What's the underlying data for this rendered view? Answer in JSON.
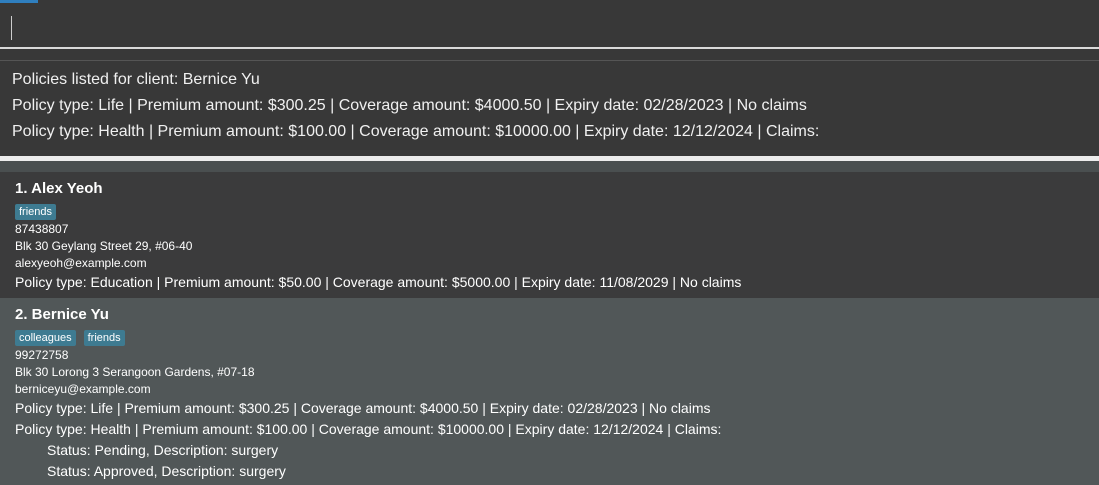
{
  "command_box": {
    "value": ""
  },
  "result": {
    "lines": [
      "Policies listed for client: Bernice Yu",
      "Policy type: Life | Premium amount: $300.25 | Coverage amount: $4000.50 | Expiry date: 02/28/2023 | No claims",
      "Policy type: Health | Premium amount: $100.00 | Coverage amount: $10000.00 | Expiry date: 12/12/2024 | Claims:"
    ]
  },
  "clients": [
    {
      "name": "1. Alex Yeoh",
      "tags": [
        "friends"
      ],
      "phone": "87438807",
      "address": "Blk 30 Geylang Street 29, #06-40",
      "email": "alexyeoh@example.com",
      "policies": [
        "Policy type: Education | Premium amount: $50.00 | Coverage amount: $5000.00 | Expiry date: 11/08/2029 | No claims"
      ]
    },
    {
      "name": "2. Bernice Yu",
      "tags": [
        "colleagues",
        "friends"
      ],
      "phone": "99272758",
      "address": "Blk 30 Lorong 3 Serangoon Gardens, #07-18",
      "email": "berniceyu@example.com",
      "policies": [
        "Policy type: Life | Premium amount: $300.25 | Coverage amount: $4000.50 | Expiry date: 02/28/2023 | No claims",
        "Policy type: Health | Premium amount: $100.00 | Coverage amount: $10000.00 | Expiry date: 12/12/2024 | Claims:"
      ],
      "claims": [
        "Status: Pending, Description: surgery",
        "Status: Approved, Description: surgery"
      ]
    }
  ]
}
